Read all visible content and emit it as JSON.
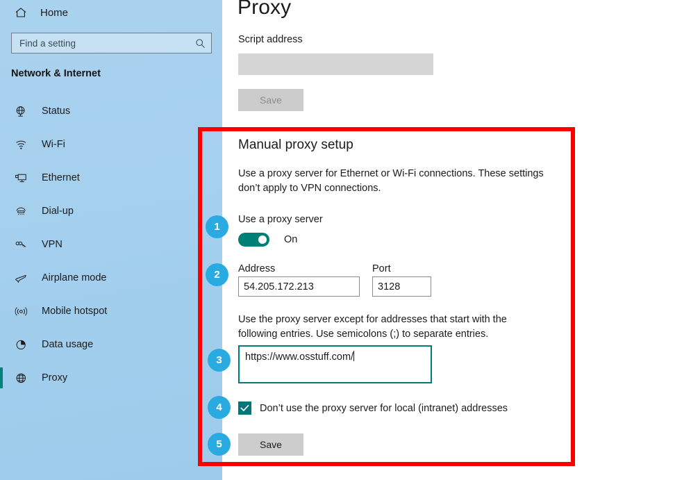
{
  "sidebar": {
    "home": {
      "label": "Home",
      "icon": "home-icon"
    },
    "search": {
      "placeholder": "Find a setting",
      "value": "",
      "icon": "search-icon"
    },
    "section_title": "Network & Internet",
    "items": [
      {
        "label": "Status",
        "icon": "globe-network-icon",
        "selected": false
      },
      {
        "label": "Wi-Fi",
        "icon": "wifi-icon",
        "selected": false
      },
      {
        "label": "Ethernet",
        "icon": "ethernet-icon",
        "selected": false
      },
      {
        "label": "Dial-up",
        "icon": "dialup-modem-icon",
        "selected": false
      },
      {
        "label": "VPN",
        "icon": "vpn-key-icon",
        "selected": false
      },
      {
        "label": "Airplane mode",
        "icon": "airplane-icon",
        "selected": false
      },
      {
        "label": "Mobile hotspot",
        "icon": "hotspot-icon",
        "selected": false
      },
      {
        "label": "Data usage",
        "icon": "pie-chart-icon",
        "selected": false
      },
      {
        "label": "Proxy",
        "icon": "globe-icon",
        "selected": true
      }
    ]
  },
  "main": {
    "page_title": "Proxy",
    "script": {
      "label": "Script address",
      "value": "",
      "save_label": "Save"
    },
    "manual": {
      "heading": "Manual proxy setup",
      "description": "Use a proxy server for Ethernet or Wi-Fi connections. These settings don’t apply to VPN connections.",
      "use_proxy_label": "Use a proxy server",
      "toggle_state": "On",
      "address_label": "Address",
      "address_value": "54.205.172.213",
      "port_label": "Port",
      "port_value": "3128",
      "exceptions_description": "Use the proxy server except for addresses that start with the following entries. Use semicolons (;) to separate entries.",
      "exceptions_value": "https://www.osstuff.com/",
      "bypass_local_label": "Don’t use the proxy server for local (intranet) addresses",
      "bypass_local_checked": true,
      "save_label": "Save"
    }
  },
  "annotations": {
    "highlight_color": "#FC0000",
    "badge_color": "#29ABE2",
    "accent_color": "#008075",
    "steps": [
      {
        "number": "1"
      },
      {
        "number": "2"
      },
      {
        "number": "3"
      },
      {
        "number": "4"
      },
      {
        "number": "5"
      }
    ]
  }
}
